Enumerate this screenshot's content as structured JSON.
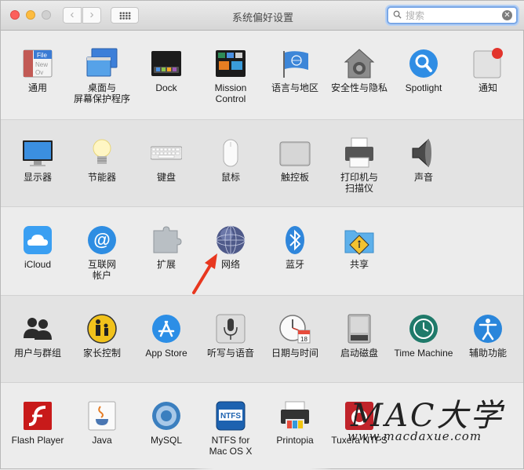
{
  "window": {
    "title": "系统偏好设置"
  },
  "toolbar": {
    "back_label": "‹",
    "forward_label": "›"
  },
  "search": {
    "placeholder": "搜索",
    "value": ""
  },
  "rows": [
    {
      "items": [
        {
          "label": "通用",
          "icon": "general-icon"
        },
        {
          "label": "桌面与\n屏幕保护程序",
          "icon": "desktop-screensaver-icon"
        },
        {
          "label": "Dock",
          "icon": "dock-icon"
        },
        {
          "label": "Mission\nControl",
          "icon": "mission-control-icon"
        },
        {
          "label": "语言与地区",
          "icon": "language-region-icon"
        },
        {
          "label": "安全性与隐私",
          "icon": "security-privacy-icon"
        },
        {
          "label": "Spotlight",
          "icon": "spotlight-icon"
        },
        {
          "label": "通知",
          "icon": "notifications-icon"
        }
      ]
    },
    {
      "items": [
        {
          "label": "显示器",
          "icon": "displays-icon"
        },
        {
          "label": "节能器",
          "icon": "energy-saver-icon"
        },
        {
          "label": "键盘",
          "icon": "keyboard-icon"
        },
        {
          "label": "鼠标",
          "icon": "mouse-icon"
        },
        {
          "label": "触控板",
          "icon": "trackpad-icon"
        },
        {
          "label": "打印机与\n扫描仪",
          "icon": "printer-scanner-icon"
        },
        {
          "label": "声音",
          "icon": "sound-icon"
        }
      ]
    },
    {
      "items": [
        {
          "label": "iCloud",
          "icon": "icloud-icon"
        },
        {
          "label": "互联网\n帐户",
          "icon": "internet-accounts-icon"
        },
        {
          "label": "扩展",
          "icon": "extensions-icon"
        },
        {
          "label": "网络",
          "icon": "network-icon"
        },
        {
          "label": "蓝牙",
          "icon": "bluetooth-icon"
        },
        {
          "label": "共享",
          "icon": "sharing-icon"
        }
      ]
    },
    {
      "items": [
        {
          "label": "用户与群组",
          "icon": "users-groups-icon"
        },
        {
          "label": "家长控制",
          "icon": "parental-controls-icon"
        },
        {
          "label": "App Store",
          "icon": "app-store-icon"
        },
        {
          "label": "听写与语音",
          "icon": "dictation-speech-icon"
        },
        {
          "label": "日期与时间",
          "icon": "date-time-icon"
        },
        {
          "label": "启动磁盘",
          "icon": "startup-disk-icon"
        },
        {
          "label": "Time Machine",
          "icon": "time-machine-icon"
        },
        {
          "label": "辅助功能",
          "icon": "accessibility-icon"
        }
      ]
    },
    {
      "items": [
        {
          "label": "Flash Player",
          "icon": "flash-player-icon"
        },
        {
          "label": "Java",
          "icon": "java-icon"
        },
        {
          "label": "MySQL",
          "icon": "mysql-icon"
        },
        {
          "label": "NTFS for\nMac OS X",
          "icon": "ntfs-icon"
        },
        {
          "label": "Printopia",
          "icon": "printopia-icon"
        },
        {
          "label": "Tuxera NTFS",
          "icon": "tuxera-ntfs-icon"
        }
      ]
    }
  ],
  "icon_text": {
    "general_file": "File",
    "general_new": "New",
    "general_ov": "Ov",
    "calendar_day": "18",
    "calendar_month": "JUL",
    "ntfs": "NTFS"
  },
  "watermark": {
    "main": "MAC大学",
    "url": "www.macdaxue.com"
  },
  "colors": {
    "accent_focus": "#7aa7e6",
    "annotation_arrow": "#e8371f",
    "close": "#fc605c",
    "minimize": "#fdbc40"
  }
}
